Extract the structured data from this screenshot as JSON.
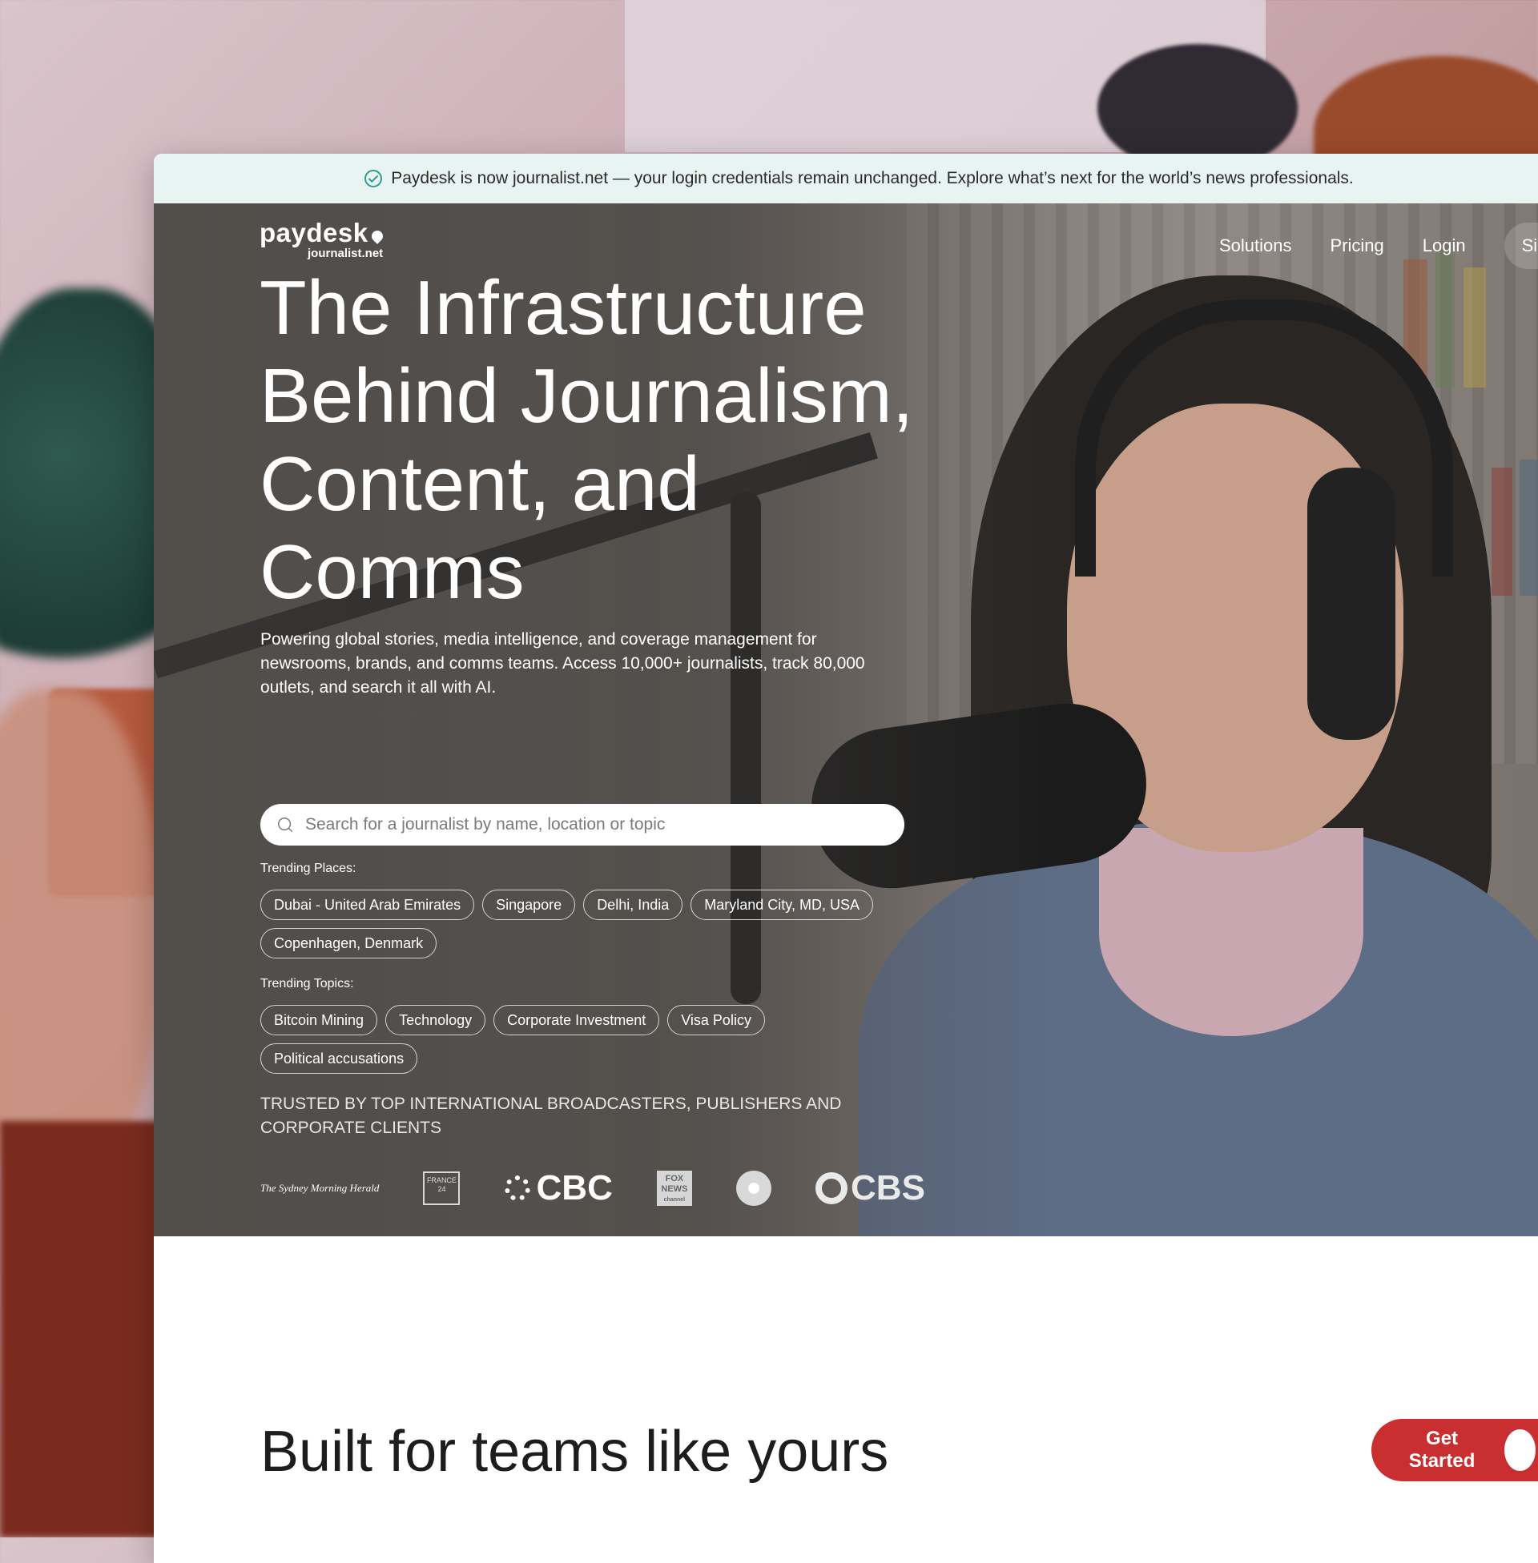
{
  "banner": {
    "text": "Paydesk is now journalist.net — your login credentials remain unchanged. Explore what’s next for the world’s news professionals."
  },
  "logo": {
    "brand": "paydesk",
    "sub": "journalist.net"
  },
  "nav": {
    "solutions": "Solutions",
    "pricing": "Pricing",
    "login": "Login",
    "signup": "Sign"
  },
  "hero": {
    "headline": "The Infrastructure Behind Journalism, Content, and Comms",
    "intro": "Powering global stories, media intelligence, and coverage management for newsrooms, brands, and comms teams. Access 10,000+ journalists, track 80,000 outlets, and search it all with AI."
  },
  "search": {
    "placeholder": "Search for a journalist by name, location or topic",
    "value": ""
  },
  "trending_places": {
    "label": "Trending Places:",
    "items": [
      "Dubai - United Arab Emirates",
      "Singapore",
      "Delhi, India",
      "Maryland City, MD, USA",
      "Copenhagen, Denmark"
    ]
  },
  "trending_topics": {
    "label": "Trending Topics:",
    "items": [
      "Bitcoin Mining",
      "Technology",
      "Corporate Investment",
      "Visa Policy",
      "Political accusations"
    ]
  },
  "trusted": {
    "text": "TRUSTED BY TOP INTERNATIONAL BROADCASTERS, PUBLISHERS AND CORPORATE CLIENTS",
    "logos": {
      "smh": "The Sydney Morning Herald",
      "f24_line1": "FRANCE",
      "f24_line2": "24",
      "cbc": "CBC",
      "fox_line1": "FOX",
      "fox_line2": "NEWS",
      "fox_line3": "channel",
      "cbs": "CBS"
    }
  },
  "section": {
    "title": "Built for teams like yours"
  },
  "cta": {
    "label": "Get Started"
  },
  "colors": {
    "accent": "#c92f30",
    "banner_bg": "#e8f4f2",
    "check": "#2f9a8a"
  }
}
